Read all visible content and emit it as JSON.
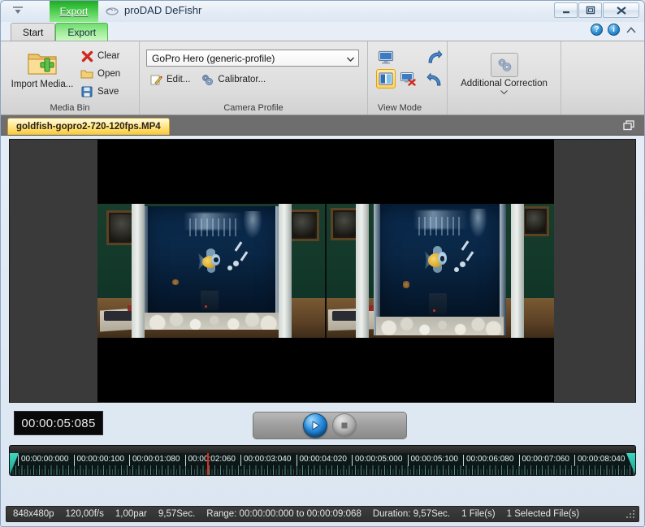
{
  "window": {
    "title": "proDAD DeFishr",
    "controls": {
      "minimize": "minimize-button",
      "maximize": "maximize-button",
      "close": "close-button"
    }
  },
  "quick_access": {
    "dropdown": "customize-quick-access",
    "export_label": "Export"
  },
  "ribbon": {
    "tabs": [
      {
        "label": "Start",
        "active": true
      },
      {
        "label": "Export",
        "active": false
      }
    ],
    "help": {
      "help_label": "?",
      "info_label": "i",
      "collapse_label": "collapse-ribbon"
    },
    "groups": [
      {
        "title": "Media Bin",
        "import_label": "Import Media...",
        "items": [
          {
            "label": "Clear",
            "icon": "red-x-icon"
          },
          {
            "label": "Open",
            "icon": "folder-open-icon"
          },
          {
            "label": "Save",
            "icon": "floppy-disk-icon"
          }
        ]
      },
      {
        "title": "Camera Profile",
        "profile_value": "GoPro Hero (generic-profile)",
        "items": [
          {
            "label": "Edit...",
            "icon": "pencil-edit-icon"
          },
          {
            "label": "Calibrator...",
            "icon": "gears-icon"
          }
        ]
      },
      {
        "title": "View Mode",
        "buttons": [
          {
            "name": "view-single-monitor",
            "selected": false
          },
          {
            "name": "view-split-compare",
            "selected": true
          },
          {
            "name": "view-disabled-monitor",
            "selected": false
          }
        ],
        "arrows": [
          {
            "name": "step-forward-arrow"
          },
          {
            "name": "step-back-arrow"
          }
        ]
      },
      {
        "title": "",
        "additional_correction_label": "Additional Correction"
      }
    ]
  },
  "document_tabs": [
    {
      "label": "goldfish-gopro2-720-120fps.MP4",
      "active": true
    }
  ],
  "preview": {
    "restore_icon": "restore-window-icon",
    "left_pane": "original-video",
    "right_pane": "corrected-video"
  },
  "transport": {
    "timecode": "00:00:05:085",
    "play_label": "play-button",
    "stop_label": "stop-button"
  },
  "timeline": {
    "labels": [
      "00:00:00:000",
      "00:00:00:100",
      "00:00:01:080",
      "00:00:02:060",
      "00:00:03:040",
      "00:00:04:020",
      "00:00:05:000",
      "00:00:05:100",
      "00:00:06:080",
      "00:00:07:060",
      "00:00:08:040"
    ],
    "playhead_position_pct": 31.5,
    "range_start_handle": "range-start-handle",
    "range_end_handle": "range-end-handle"
  },
  "status": {
    "resolution": "848x480p",
    "framerate": "120,00f/s",
    "par": "1,00par",
    "seconds": "9,57Sec.",
    "range": "Range: 00:00:00:000 to 00:00:09:068",
    "duration": "Duration: 9,57Sec.",
    "files": "1 File(s)",
    "selected_files": "1 Selected File(s)"
  },
  "colors": {
    "accent_green": "#41c844",
    "tab_yellow": "#ffe27a",
    "timeline_teal": "#3fd6c0",
    "playhead_red": "#e02b1e"
  }
}
